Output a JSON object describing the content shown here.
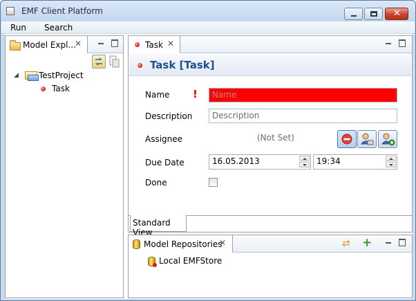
{
  "window": {
    "title": "EMF Client Platform",
    "controls": {
      "minimize": "minimize",
      "maximize": "maximize",
      "close": "✕"
    }
  },
  "menubar": {
    "items": [
      "Run",
      "Search"
    ]
  },
  "model_explorer": {
    "tab_label": "Model Expl...",
    "tree": {
      "project": {
        "expander": "◢",
        "label": "TestProject"
      },
      "children": [
        {
          "label": "Task"
        }
      ]
    }
  },
  "editor": {
    "tab_label": "Task",
    "title": "Task [Task]",
    "fields": {
      "name": {
        "label": "Name",
        "placeholder": "Name",
        "value": "",
        "error_mark": "!"
      },
      "description": {
        "label": "Description",
        "placeholder": "Description",
        "value": ""
      },
      "assignee": {
        "label": "Assignee",
        "value": "(Not Set)"
      },
      "due_date": {
        "label": "Due Date",
        "date": "16.05.2013",
        "time": "19:34"
      },
      "done": {
        "label": "Done",
        "checked": false
      }
    },
    "bottom_tab": "Standard View"
  },
  "repositories": {
    "tab_label": "Model Repositories",
    "items": [
      {
        "label": "Local EMFStore"
      }
    ]
  },
  "colors": {
    "accent_title": "#1f4f8f",
    "error_field": "#ff0000",
    "error_mark": "#d40000",
    "close_button": "#c9452f"
  },
  "icons": {
    "window": "application-icon",
    "model_explorer_tab": "folder-icon",
    "task": "red-dot-icon",
    "link_with_editor": "link-editor-icon",
    "new_project": "new-file-icon",
    "unset_assignee": "remove-icon",
    "select_assignee": "user-select-icon",
    "add_assignee": "user-add-icon",
    "repositories_tab": "repository-icon",
    "refresh": "refresh-icon",
    "add_repository": "plus-icon",
    "local_store": "database-icon"
  }
}
